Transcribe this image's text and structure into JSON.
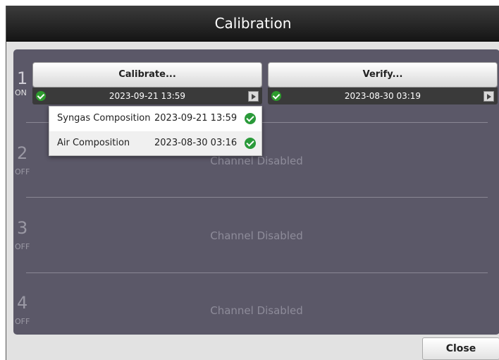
{
  "window": {
    "title": "Calibration",
    "close_label": "Close"
  },
  "channels": [
    {
      "number": "1",
      "state": "ON",
      "calibrate": {
        "label": "Calibrate...",
        "date": "2023-09-21 13:59"
      },
      "verify": {
        "label": "Verify...",
        "date": "2023-08-30 03:19"
      }
    },
    {
      "number": "2",
      "state": "OFF",
      "disabled_text": "Channel Disabled"
    },
    {
      "number": "3",
      "state": "OFF",
      "disabled_text": "Channel Disabled"
    },
    {
      "number": "4",
      "state": "OFF",
      "disabled_text": "Channel Disabled"
    }
  ],
  "calibration_popup": {
    "rows": [
      {
        "name": "Syngas Composition",
        "date": "2023-09-21 13:59",
        "status": "ok"
      },
      {
        "name": "Air Composition",
        "date": "2023-08-30 03:16",
        "status": "ok"
      }
    ]
  },
  "colors": {
    "titlebar": "#1e1e1e",
    "panel": "#5b5868",
    "status_ok": "#2d9b2d",
    "status_bar": "#3a3a3a"
  },
  "icons": {
    "status_ok": "check-circle-icon",
    "details": "chevron-right-icon"
  }
}
